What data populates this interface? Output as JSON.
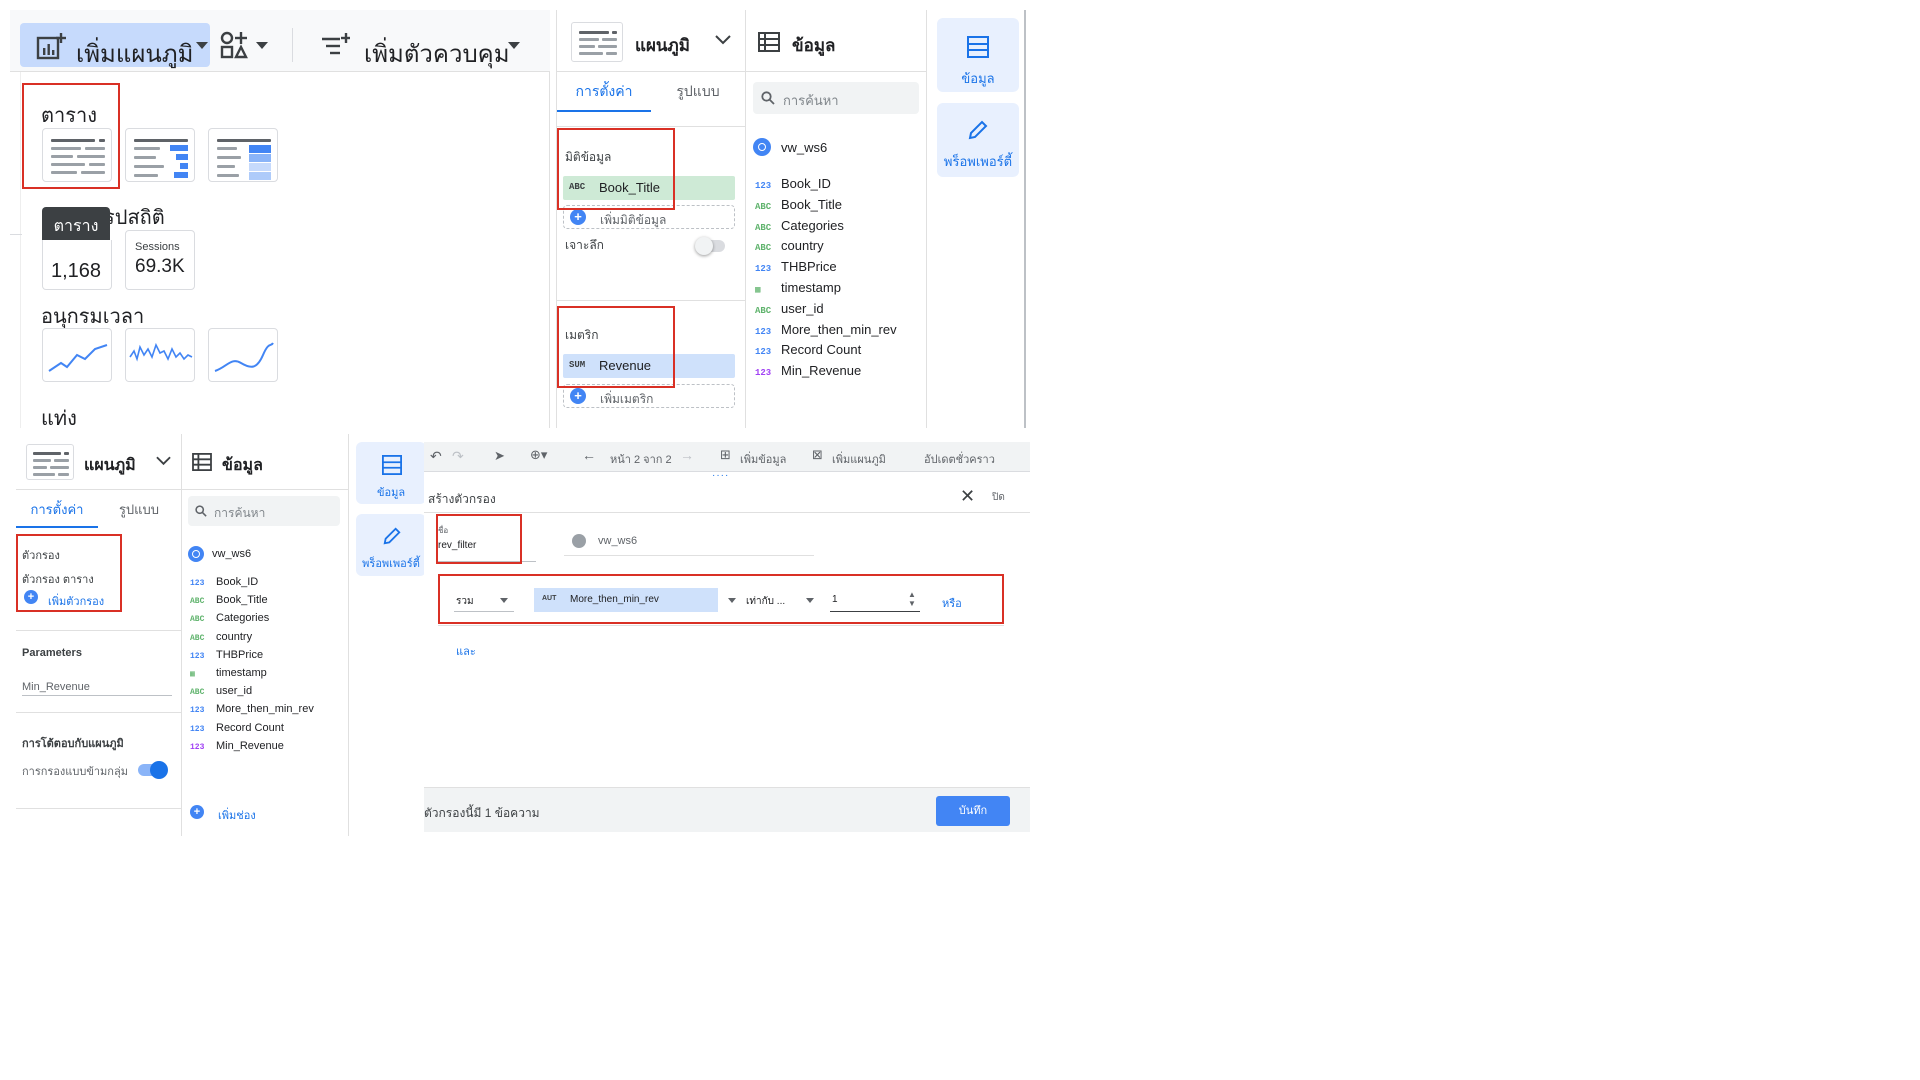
{
  "q1": {
    "toolbar": {
      "add_chart": "เพิ่มแผนภูมิ",
      "add_control": "เพิ่มตัวควบคุม"
    },
    "menu": {
      "section_table": "ตาราง",
      "section_scorecard": "รปสถิติ",
      "tooltip": "ตาราง",
      "scorecard1_value": "1,168",
      "scorecard2_label": "Sessions",
      "scorecard2_value": "69.3K",
      "section_timeseries": "อนุกรมเวลา",
      "section_bar": "แท่ง"
    }
  },
  "q2": {
    "chart_title": "แผนภูมิ",
    "data_title": "ข้อมูล",
    "tab_setup": "การตั้งค่า",
    "tab_style": "รูปแบบ",
    "dim_label": "มิติข้อมูล",
    "dim_chip_type": "ABC",
    "dim_chip": "Book_Title",
    "add_dim": "เพิ่มมิติข้อมูล",
    "drill_label": "เจาะลึก",
    "metric_label": "เมตริก",
    "metric_chip_type": "SUM",
    "metric_chip": "Revenue",
    "add_metric": "เพิ่มเมตริก",
    "search_placeholder": "การค้นหา",
    "datasource": "vw_ws6",
    "fields": [
      {
        "type": "123",
        "name": "Book_ID"
      },
      {
        "type": "ABC",
        "name": "Book_Title"
      },
      {
        "type": "ABC",
        "name": "Categories"
      },
      {
        "type": "ABC",
        "name": "country"
      },
      {
        "type": "123",
        "name": "THBPrice"
      },
      {
        "type": "date",
        "name": "timestamp"
      },
      {
        "type": "ABC",
        "name": "user_id"
      },
      {
        "type": "123",
        "name": "More_then_min_rev"
      },
      {
        "type": "123",
        "name": "Record Count"
      },
      {
        "type": "123m",
        "name": "Min_Revenue"
      }
    ],
    "side_data": "ข้อมูล",
    "side_props": "พร็อพเพอร์ตี้"
  },
  "q3": {
    "chart_title": "แผนภูมิ",
    "data_title": "ข้อมูล",
    "tab_setup": "การตั้งค่า",
    "tab_style": "รูปแบบ",
    "filter_label": "ตัวกรอง",
    "filter_table": "ตัวกรอง ตาราง",
    "add_filter": "เพิ่มตัวกรอง",
    "params_label": "Parameters",
    "param_name": "Min_Revenue",
    "interaction_label": "การโต้ตอบกับแผนภูมิ",
    "cross_filter": "การกรองแบบข้ามกลุ่ม",
    "search_placeholder": "การค้นหา",
    "datasource": "vw_ws6",
    "fields": [
      {
        "type": "123",
        "name": "Book_ID"
      },
      {
        "type": "ABC",
        "name": "Book_Title"
      },
      {
        "type": "ABC",
        "name": "Categories"
      },
      {
        "type": "ABC",
        "name": "country"
      },
      {
        "type": "123",
        "name": "THBPrice"
      },
      {
        "type": "date",
        "name": "timestamp"
      },
      {
        "type": "ABC",
        "name": "user_id"
      },
      {
        "type": "123",
        "name": "More_then_min_rev"
      },
      {
        "type": "123",
        "name": "Record Count"
      },
      {
        "type": "123m",
        "name": "Min_Revenue"
      }
    ],
    "add_field": "เพิ่มช่อง",
    "side_data": "ข้อมูล",
    "side_props": "พร็อพเพอร์ตี้"
  },
  "q4": {
    "toolbar": {
      "page": "หน้า 2 จาก 2",
      "add_data": "เพิ่มข้อมูล",
      "add_chart": "เพิ่มแผนภูมิ",
      "refresh": "อัปเดตชั่วคราว"
    },
    "dialog_title": "สร้างตัวกรอง",
    "close": "ปิด",
    "name_label": "ชื่อ",
    "name_value": "rev_filter",
    "datasource": "vw_ws6",
    "include": "รวม",
    "field_type": "AUT",
    "field": "More_then_min_rev",
    "operator": "เท่ากับ ...",
    "value": "1",
    "or": "หรือ",
    "and": "และ",
    "footer_text": "ตัวกรองนี้มี 1 ข้อความ",
    "save": "บันทึก"
  }
}
